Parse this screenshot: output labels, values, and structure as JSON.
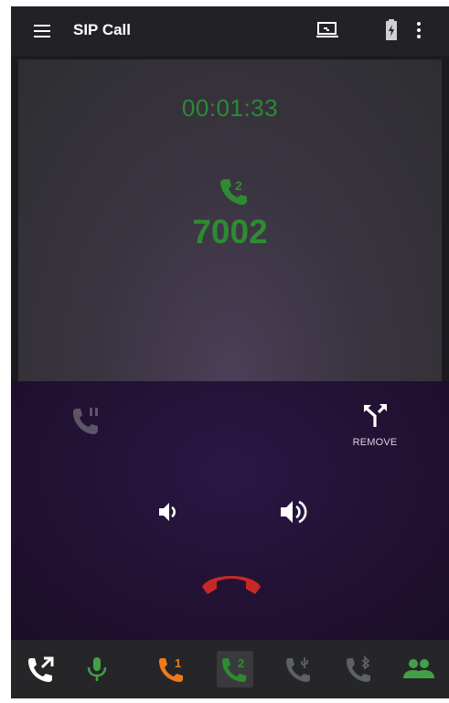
{
  "app": {
    "title": "SIP Call"
  },
  "call": {
    "timer": "00:01:33",
    "active_line": "2",
    "number": "7002"
  },
  "controls": {
    "remove_label": "REMOVE"
  },
  "bottom_bar": {
    "line1_label": "1",
    "line2_label": "2"
  },
  "icons": {
    "menu": "hamburger-menu-icon",
    "cast": "cast-screen-icon",
    "battery": "battery-charging-icon",
    "overflow": "more-vert-icon",
    "hold": "phone-paused-icon",
    "remove": "call-merge-split-icon",
    "volume_down": "volume-down-icon",
    "volume_up": "volume-up-icon",
    "hangup": "call-end-icon",
    "transfer": "phone-forwarded-icon",
    "mic": "microphone-icon",
    "usb_line": "phone-usb-icon",
    "bluetooth_line": "phone-bluetooth-icon",
    "contacts": "people-icon"
  },
  "colors": {
    "accent_green": "#2e8b32",
    "line1_orange": "#f07a1a",
    "hangup_red": "#c62828",
    "mic_green": "#43a047"
  }
}
